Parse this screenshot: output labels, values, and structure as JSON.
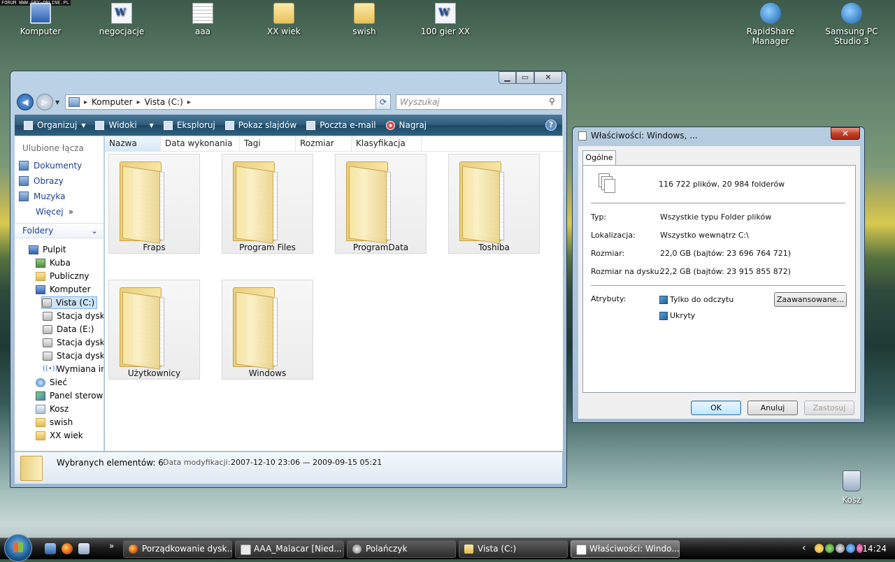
{
  "watermark": "FORUM WWW.GRY-ONLINE.PL",
  "desktop": {
    "icons": [
      {
        "label": "Komputer",
        "icon": "computer-icon"
      },
      {
        "label": "negocjacje",
        "icon": "word-doc-icon"
      },
      {
        "label": "aaa",
        "icon": "text-file-icon"
      },
      {
        "label": "XX wiek",
        "icon": "folder-icon"
      },
      {
        "label": "swish",
        "icon": "folder-icon"
      },
      {
        "label": "100 gier XX",
        "icon": "word-doc-icon"
      },
      {
        "label": "RapidShare Manager",
        "icon": "app-shortcut-icon"
      },
      {
        "label": "Samsung PC Studio 3",
        "icon": "app-shortcut-icon"
      },
      {
        "label": "Kosz",
        "icon": "recycle-bin-icon"
      }
    ]
  },
  "explorer": {
    "controls": {
      "minimize": "▁",
      "maximize": "▭",
      "close": "✕"
    },
    "address": {
      "crumbs": [
        "Komputer",
        "Vista (C:)"
      ]
    },
    "search": {
      "placeholder": "Wyszukaj"
    },
    "toolbar": {
      "organize": "Organizuj",
      "views": "Widoki",
      "explore": "Eksploruj",
      "slideshow": "Pokaz slajdów",
      "email": "Poczta e-mail",
      "burn": "Nagraj",
      "help": "?"
    },
    "favorites": {
      "title": "Ulubione łącza",
      "items": [
        "Dokumenty",
        "Obrazy",
        "Muzyka",
        "Więcej"
      ]
    },
    "folders": {
      "title": "Foldery",
      "tree": [
        "Pulpit",
        "Kuba",
        "Publiczny",
        "Komputer",
        "Vista (C:)",
        "Stacja dyskó",
        "Data (E:)",
        "Stacja dyskó",
        "Stacja dyskó",
        "Wymiana in",
        "Sieć",
        "Panel sterowa",
        "Kosz",
        "swish",
        "XX wiek"
      ]
    },
    "columns": [
      "Nazwa",
      "Data wykonania",
      "Tagi",
      "Rozmiar",
      "Klasyfikacja"
    ],
    "items": [
      "Fraps",
      "Program Files",
      "ProgramData",
      "Toshiba",
      "Użytkownicy",
      "Windows"
    ],
    "status": {
      "selected": "Wybranych elementów: 6",
      "modified_label": "Data modyfikacji:",
      "modified_value": "2007-12-10 23:06 — 2009-09-15 05:21"
    }
  },
  "properties": {
    "title": "Właściwości: Windows, ...",
    "tab": "Ogólne",
    "summary": "116 722 plików, 20 984 folderów",
    "rows": [
      {
        "label": "Typ:",
        "value": "Wszystkie typu Folder plików"
      },
      {
        "label": "Lokalizacja:",
        "value": "Wszystko wewnątrz C:\\"
      },
      {
        "label": "Rozmiar:",
        "value": "22,0 GB (bajtów: 23 696 764 721)"
      },
      {
        "label": "Rozmiar na dysku:",
        "value": "22,2 GB (bajtów: 23 915 855 872)"
      }
    ],
    "attributes_label": "Atrybuty:",
    "readonly": "Tylko do odczytu",
    "hidden": "Ukryty",
    "advanced": "Zaawansowane...",
    "ok": "OK",
    "cancel": "Anuluj",
    "apply": "Zastosuj",
    "close": "✕"
  },
  "taskbar": {
    "more": "»",
    "tasks": [
      {
        "label": "Porządkowanie dysk..."
      },
      {
        "label": "AAA_Malacar [Nied..."
      },
      {
        "label": "Polańczyk"
      },
      {
        "label": "Vista (C:)"
      },
      {
        "label": "Właściwości: Windo..."
      }
    ],
    "tray_arrow": "‹",
    "clock": "14:24"
  }
}
